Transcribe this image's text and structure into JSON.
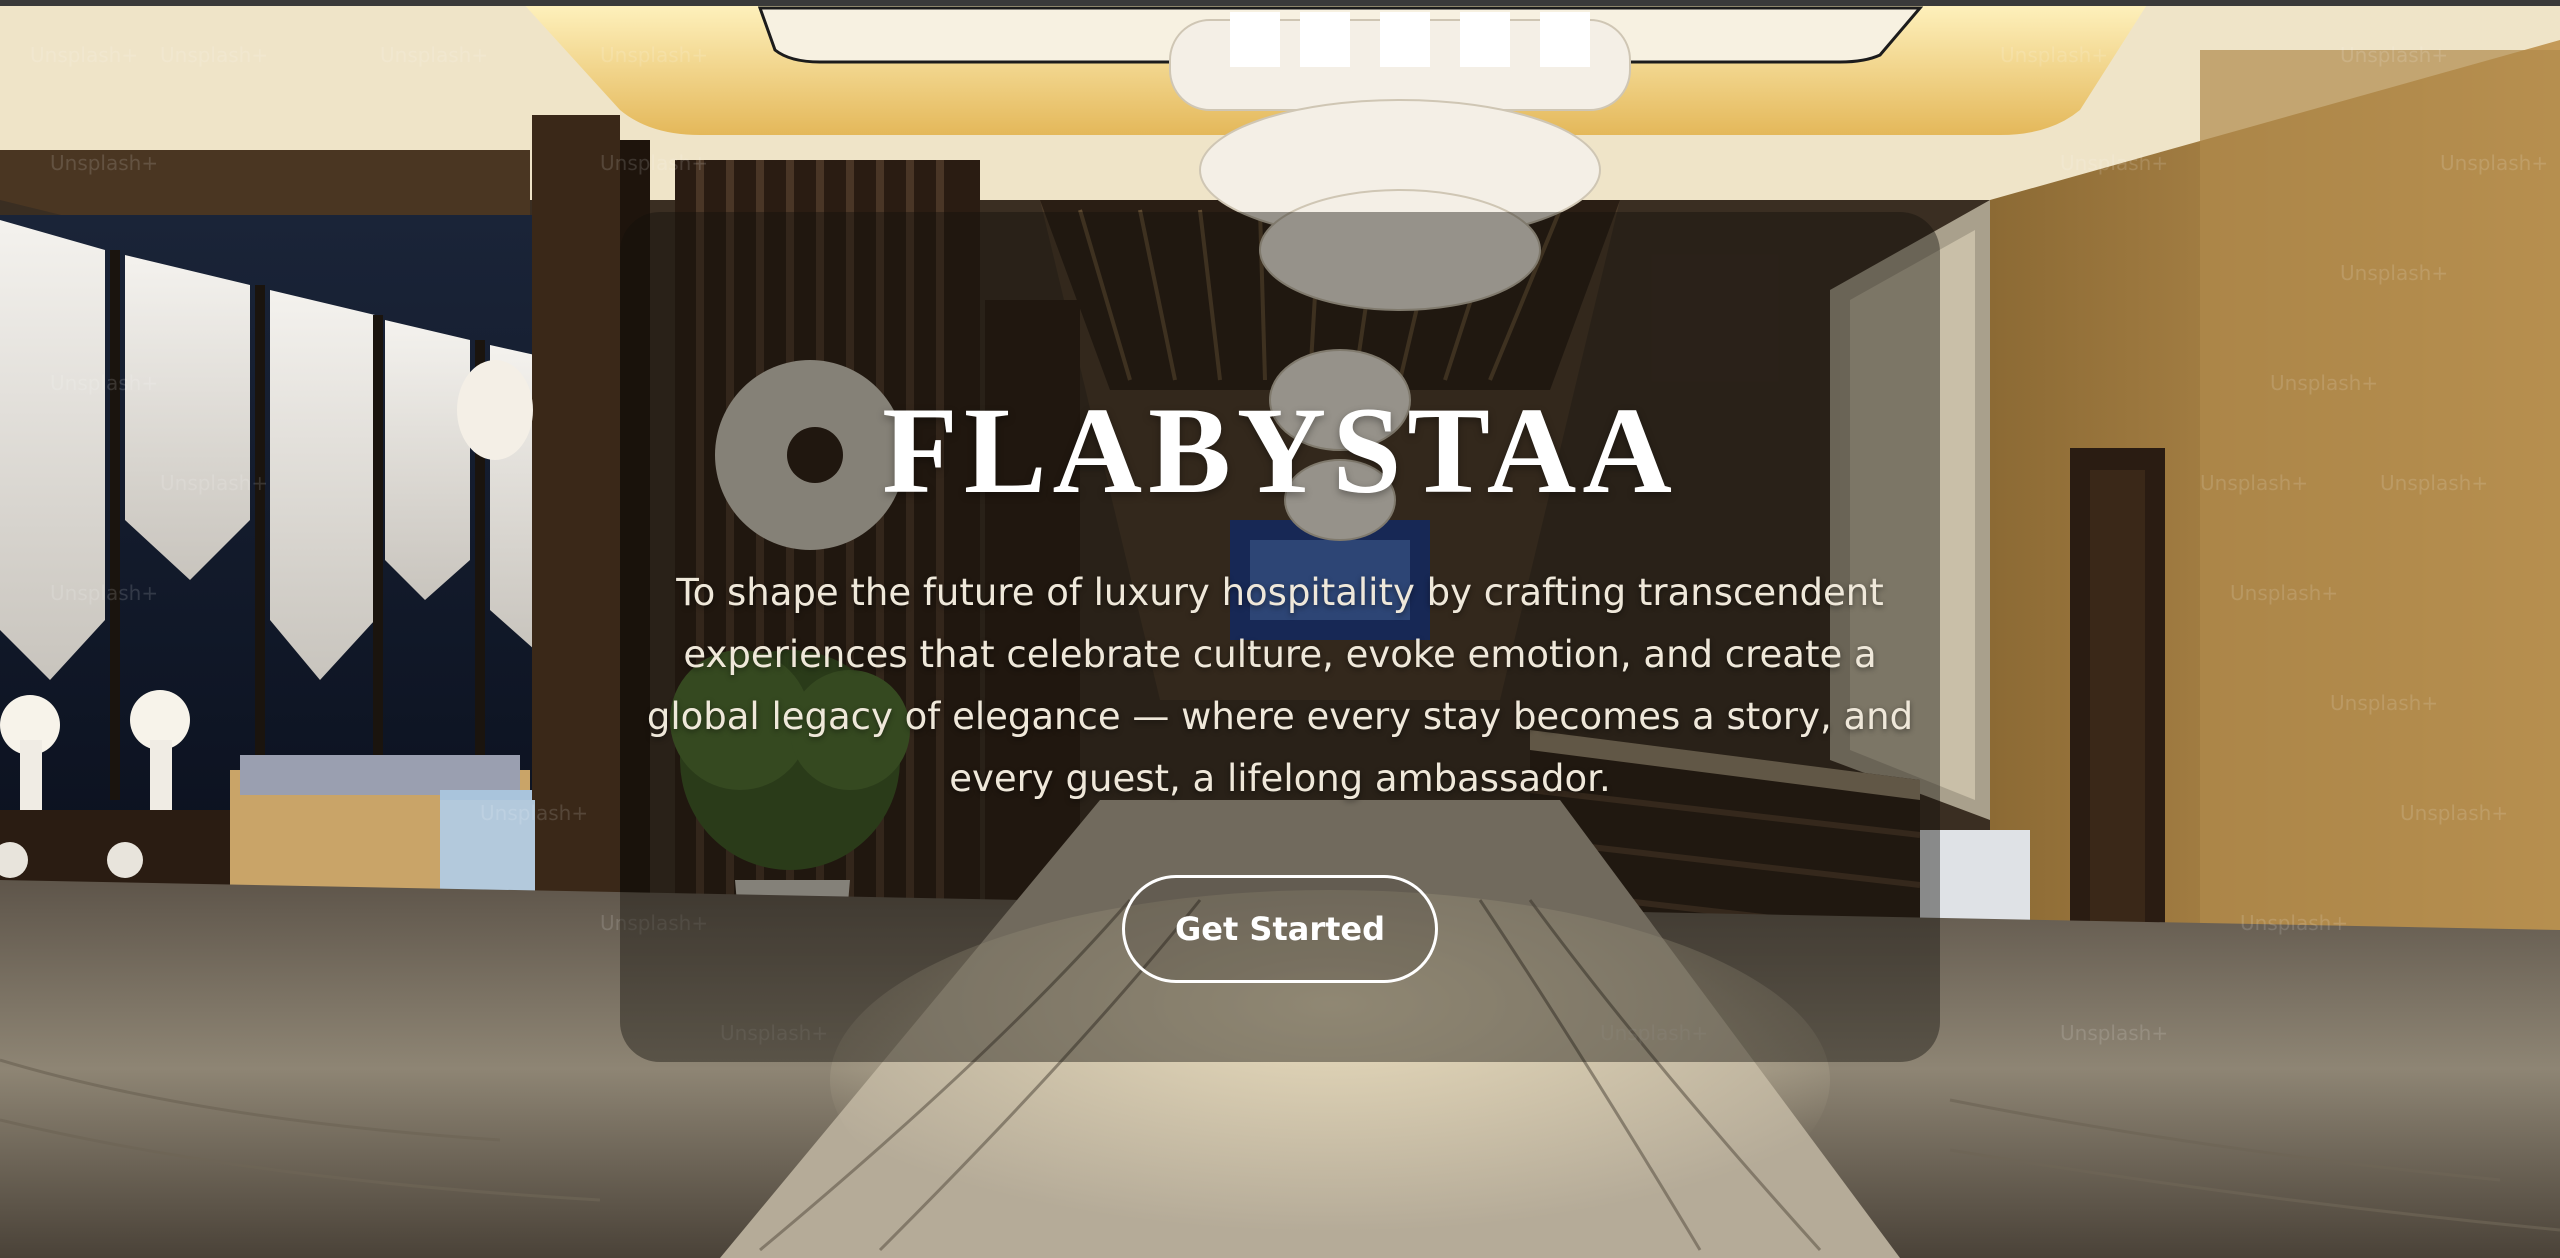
{
  "hero": {
    "brand": "FLABYSTAA",
    "mission": "To shape the future of luxury hospitality by crafting transcendent experiences that celebrate culture, evoke emotion, and create a global legacy of elegance — where every stay becomes a story, and every guest, a lifelong ambassador.",
    "cta_label": "Get Started"
  },
  "background": {
    "watermark_text": "Unsplash+",
    "scene": "luxury-hotel-lobby",
    "colors": {
      "ceiling_glow": "#f5d98a",
      "wall_gold": "#b8924e",
      "wood_dark": "#2e2218",
      "marble_floor": "#8a8070",
      "overlay": "#14100c"
    }
  }
}
